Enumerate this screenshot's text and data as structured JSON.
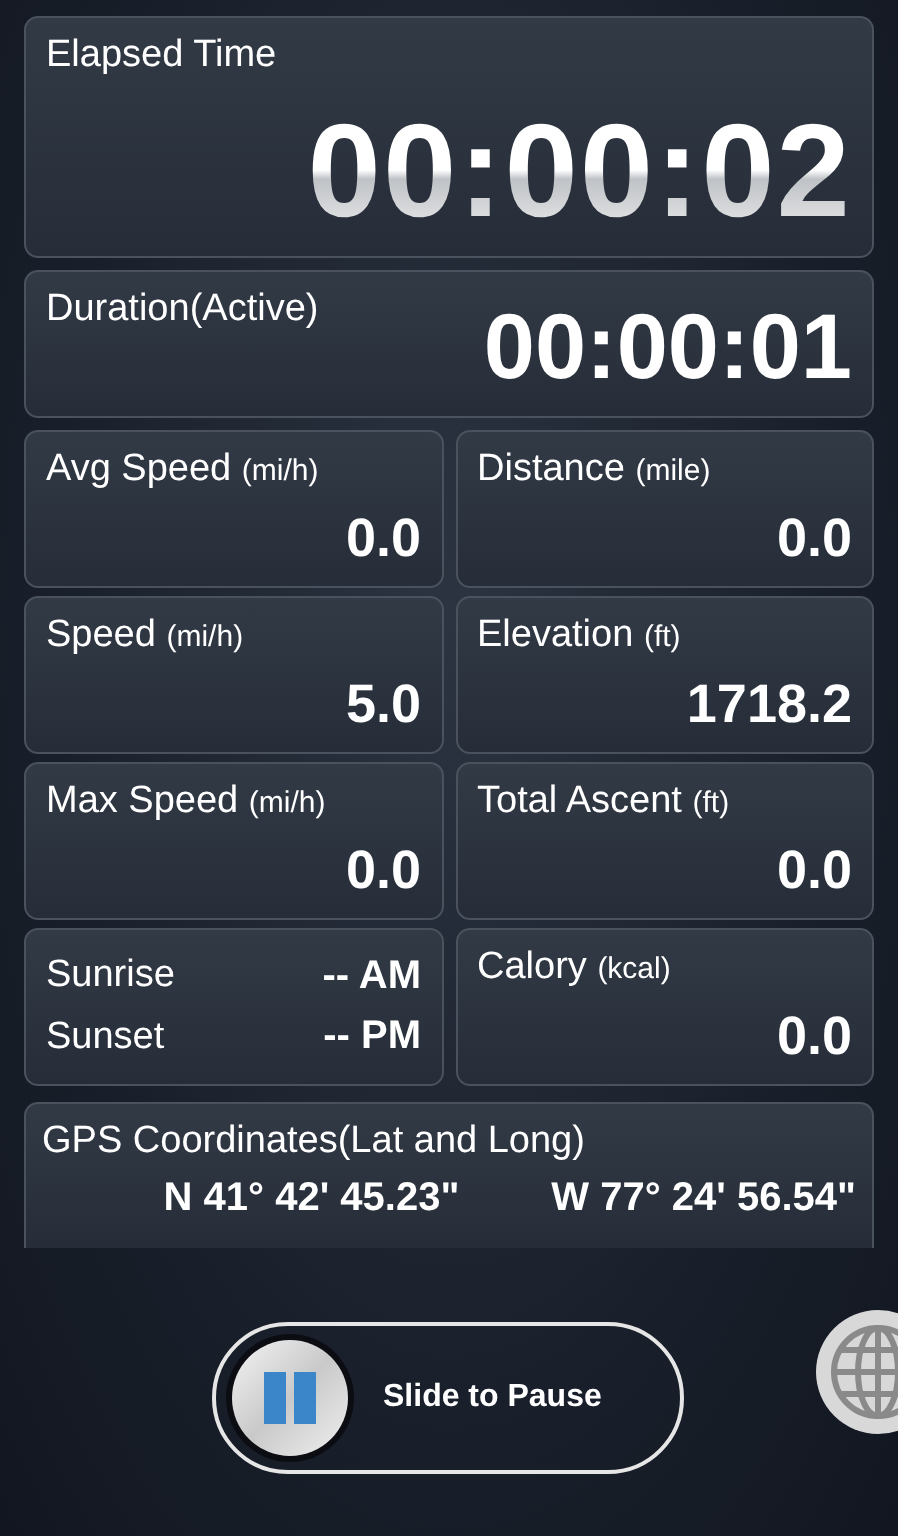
{
  "elapsed": {
    "label": "Elapsed Time",
    "value": "00:00:02"
  },
  "duration": {
    "label": "Duration(Active)",
    "value": "00:00:01"
  },
  "metrics": [
    {
      "kind": "stat",
      "label": "Avg Speed",
      "unit": "(mi/h)",
      "value": "0.0"
    },
    {
      "kind": "stat",
      "label": "Distance",
      "unit": "(mile)",
      "value": "0.0"
    },
    {
      "kind": "stat",
      "label": "Speed",
      "unit": "(mi/h)",
      "value": "5.0"
    },
    {
      "kind": "stat",
      "label": "Elevation",
      "unit": "(ft)",
      "value": "1718.2"
    },
    {
      "kind": "stat",
      "label": "Max Speed",
      "unit": "(mi/h)",
      "value": "0.0"
    },
    {
      "kind": "stat",
      "label": "Total Ascent",
      "unit": "(ft)",
      "value": "0.0"
    },
    {
      "kind": "sun",
      "rows": [
        {
          "label": "Sunrise",
          "value": "-- AM"
        },
        {
          "label": "Sunset",
          "value": "-- PM"
        }
      ]
    },
    {
      "kind": "stat",
      "label": "Calory",
      "unit": "(kcal)",
      "value": "0.0"
    }
  ],
  "gps": {
    "label": "GPS Coordinates(Lat and Long)",
    "lat": "N 41° 42' 45.23\"",
    "long": "W 77° 24' 56.54\""
  },
  "slider": {
    "label": "Slide to Pause",
    "level": 0
  }
}
